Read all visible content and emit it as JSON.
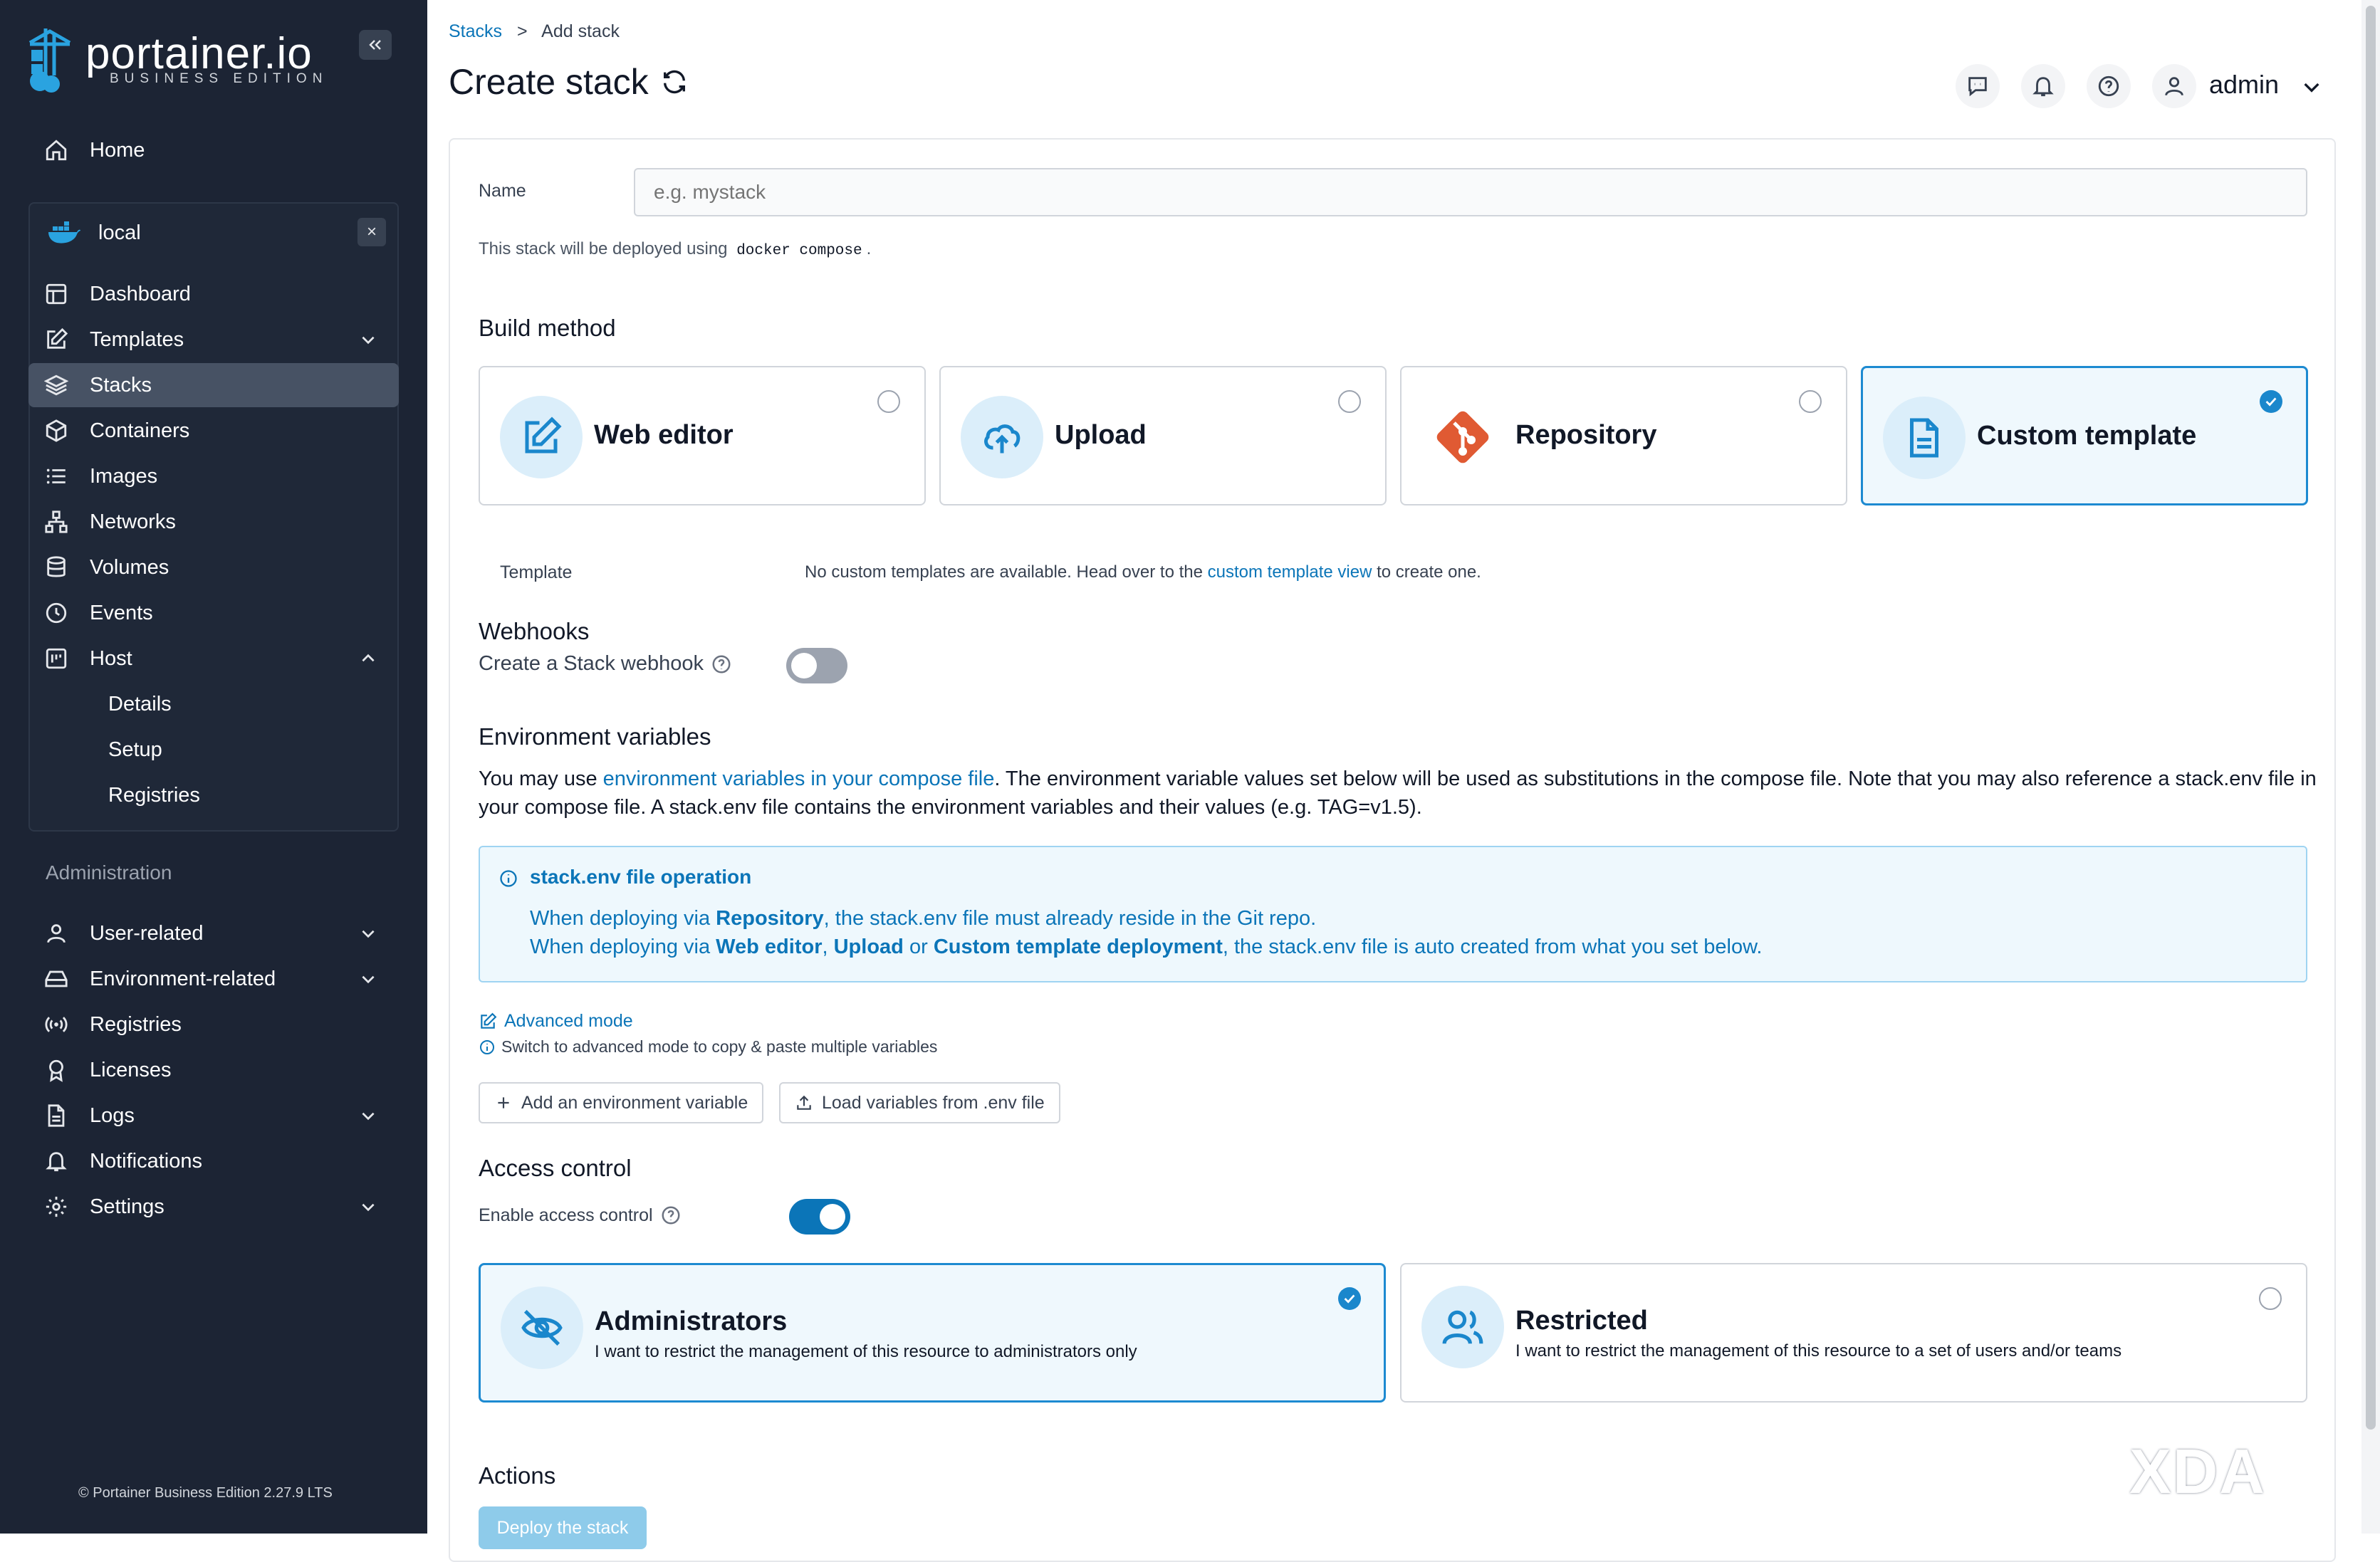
{
  "sidebar": {
    "logo_text": "portainer.io",
    "logo_sub": "BUSINESS EDITION",
    "home": "Home",
    "environment": {
      "name": "local",
      "close": "×"
    },
    "env_items": [
      {
        "label": "Dashboard",
        "icon": "dashboard-icon"
      },
      {
        "label": "Templates",
        "icon": "edit-icon"
      },
      {
        "label": "Stacks",
        "icon": "layers-icon"
      },
      {
        "label": "Containers",
        "icon": "box-icon"
      },
      {
        "label": "Images",
        "icon": "list-icon"
      },
      {
        "label": "Networks",
        "icon": "network-icon"
      },
      {
        "label": "Volumes",
        "icon": "database-icon"
      },
      {
        "label": "Events",
        "icon": "clock-icon"
      },
      {
        "label": "Host",
        "icon": "host-icon"
      }
    ],
    "host_sub": [
      "Details",
      "Setup",
      "Registries"
    ],
    "admin_title": "Administration",
    "admin_items": [
      {
        "label": "User-related",
        "icon": "user-icon"
      },
      {
        "label": "Environment-related",
        "icon": "drive-icon"
      },
      {
        "label": "Registries",
        "icon": "radio-icon"
      },
      {
        "label": "Licenses",
        "icon": "award-icon"
      },
      {
        "label": "Logs",
        "icon": "file-icon"
      },
      {
        "label": "Notifications",
        "icon": "bell-icon"
      },
      {
        "label": "Settings",
        "icon": "gear-icon"
      }
    ],
    "footer": "© Portainer Business Edition 2.27.9 LTS"
  },
  "header": {
    "breadcrumb_link": "Stacks",
    "breadcrumb_sep": ">",
    "breadcrumb_current": "Add stack",
    "title": "Create stack",
    "user": "admin"
  },
  "form": {
    "name_label": "Name",
    "name_placeholder": "e.g. mystack",
    "deploy_hint_pre": "This stack will be deployed using",
    "deploy_hint_code": "docker compose",
    "deploy_hint_post": ".",
    "build_method_title": "Build method",
    "build_methods": [
      {
        "label": "Web editor",
        "selected": false
      },
      {
        "label": "Upload",
        "selected": false
      },
      {
        "label": "Repository",
        "selected": false
      },
      {
        "label": "Custom template",
        "selected": true
      }
    ],
    "template_label": "Template",
    "template_msg_pre": "No custom templates are available. Head over to the",
    "template_msg_link": "custom template view",
    "template_msg_post": "to create one.",
    "webhooks_title": "Webhooks",
    "webhook_label": "Create a Stack webhook",
    "webhook_enabled": false,
    "env_title": "Environment variables",
    "env_desc_pre": "You may use",
    "env_desc_link": "environment variables in your compose file",
    "env_desc_post": ". The environment variable values set below will be used as substitutions in the compose file. Note that you may also reference a stack.env file in your compose file. A stack.env file contains the environment variables and their values (e.g. TAG=v1.5).",
    "info_title": "stack.env file operation",
    "info_l1_a": "When deploying via",
    "info_l1_b": "Repository",
    "info_l1_c": ", the stack.env file must already reside in the Git repo.",
    "info_l2_a": "When deploying via",
    "info_l2_b": "Web editor",
    "info_l2_c": ",",
    "info_l2_d": "Upload",
    "info_l2_e": "or",
    "info_l2_f": "Custom template deployment",
    "info_l2_g": ", the stack.env file is auto created from what you set below.",
    "advanced_mode": "Advanced mode",
    "advanced_hint": "Switch to advanced mode to copy & paste multiple variables",
    "add_env_btn": "Add an environment variable",
    "load_env_btn": "Load variables from .env file",
    "access_title": "Access control",
    "access_label": "Enable access control",
    "access_enabled": true,
    "access_options": [
      {
        "title": "Administrators",
        "desc": "I want to restrict the management of this resource to administrators only",
        "selected": true
      },
      {
        "title": "Restricted",
        "desc": "I want to restrict the management of this resource to a set of users and/or teams",
        "selected": false
      }
    ],
    "actions_title": "Actions",
    "deploy_btn": "Deploy the stack"
  },
  "watermark": "XDA",
  "colors": {
    "sidebar": "#1c2434",
    "accent": "#0b75b8",
    "selected_bg": "#eff8fd",
    "repo_icon": "#e05a33"
  }
}
